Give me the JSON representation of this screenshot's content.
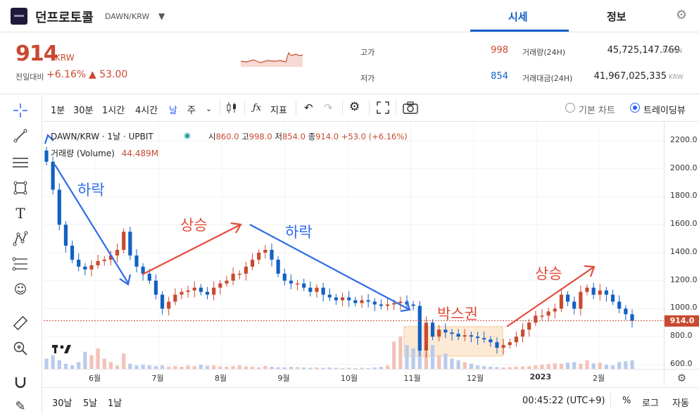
{
  "header": {
    "coin_name": "던프로토콜",
    "pair": "DAWN/KRW",
    "tabs": [
      {
        "label": "시세",
        "active": true
      },
      {
        "label": "정보",
        "active": false
      }
    ]
  },
  "ticker": {
    "price": "914",
    "currency": "KRW",
    "change_label": "전일대비",
    "change_pct": "+6.16%",
    "change_amt": "▲ 53.00",
    "high_label": "고가",
    "high": "998",
    "low_label": "저가",
    "low": "854",
    "volume_label": "거래량(24H)",
    "volume": "45,725,147.769",
    "volume_unit": "DAWN",
    "amount_label": "거래대금(24H)",
    "amount": "41,967,025,335",
    "amount_unit": "KRW",
    "up_color": "#c84a31",
    "down_color": "#1261c4"
  },
  "toolbar": {
    "intervals": [
      "1분",
      "30분",
      "1시간",
      "4시간",
      "날",
      "주"
    ],
    "active_interval": "날",
    "indicators_label": "지표",
    "chart_modes": [
      "기본 차트",
      "트레이딩뷰"
    ],
    "active_mode": "트레이딩뷰"
  },
  "legend": {
    "symbol": "DAWN/KRW · 1날 · UPBIT",
    "open_label": "시",
    "open": "860.0",
    "high_label": "고",
    "high": "998.0",
    "low_label": "저",
    "low": "854.0",
    "close_label": "종",
    "close": "914.0",
    "change": "+53.0 (+6.16%)",
    "volume_label": "거래량 (Volume)",
    "volume": "44.489M"
  },
  "annotations": {
    "fall1": "하락",
    "rise1": "상승",
    "fall2": "하락",
    "box": "박스권",
    "rise2": "상승"
  },
  "chart_data": {
    "type": "line",
    "title": "",
    "xlabel": "",
    "ylabel": "",
    "ylim": [
      600,
      2250
    ],
    "y_ticks": [
      600,
      800,
      1000,
      1200,
      1400,
      1600,
      1800,
      2000,
      2200
    ],
    "x_ticks": [
      "6월",
      "7월",
      "8월",
      "9월",
      "10월",
      "11월",
      "12월",
      "2023",
      "2월"
    ],
    "current_price": 914,
    "series": [
      {
        "values": [
          2050,
          1850,
          1600,
          1450,
          1350,
          1300,
          1280,
          1310,
          1340,
          1350,
          1380,
          1420,
          1550,
          1380,
          1300,
          1250,
          1200,
          1100,
          1000,
          1050,
          1100,
          1120,
          1130,
          1150,
          1120,
          1100,
          1150,
          1180,
          1200,
          1250,
          1250,
          1300,
          1350,
          1400,
          1420,
          1350,
          1250,
          1200,
          1180,
          1180,
          1150,
          1120,
          1150,
          1100,
          1080,
          1060,
          1080,
          1060,
          1040,
          1060,
          1050,
          1030,
          1020,
          1030,
          1040,
          1050,
          1030,
          1020,
          700,
          900,
          800,
          850,
          830,
          820,
          800,
          810,
          800,
          790,
          780,
          760,
          720,
          740,
          760,
          800,
          850,
          900,
          950,
          950,
          980,
          1000,
          1100,
          1050,
          1000,
          1120,
          1150,
          1100,
          1130,
          1100,
          1050,
          1000,
          960,
          914
        ]
      }
    ],
    "volume_series": [
      {
        "name": "거래량 (Volume)",
        "values": [
          30,
          40,
          25,
          15,
          10,
          20,
          50,
          40,
          60,
          30,
          20,
          10,
          45,
          15,
          10,
          12,
          10,
          8,
          10,
          6,
          8,
          6,
          10,
          8,
          12,
          9,
          10,
          7,
          6,
          8,
          10,
          7,
          6,
          5,
          8,
          6,
          5,
          4,
          6,
          5,
          4,
          3,
          4,
          3,
          4,
          3,
          2,
          3,
          2,
          3,
          2,
          4,
          6,
          10,
          80,
          95,
          70,
          60,
          55,
          50,
          70,
          40,
          45,
          30,
          25,
          20,
          15,
          10,
          8,
          6,
          5,
          4,
          5,
          6,
          7,
          8,
          10,
          12,
          14,
          16,
          15,
          18,
          20,
          15,
          25,
          16,
          18,
          12,
          10,
          20,
          22,
          25
        ]
      }
    ]
  },
  "axis": {
    "price_tag": "914.0",
    "time_display": "00:45:22 (UTC+9)",
    "ranges": [
      "30날",
      "5날",
      "1날"
    ],
    "percent_label": "%",
    "log_label": "로그",
    "auto_label": "자동"
  }
}
